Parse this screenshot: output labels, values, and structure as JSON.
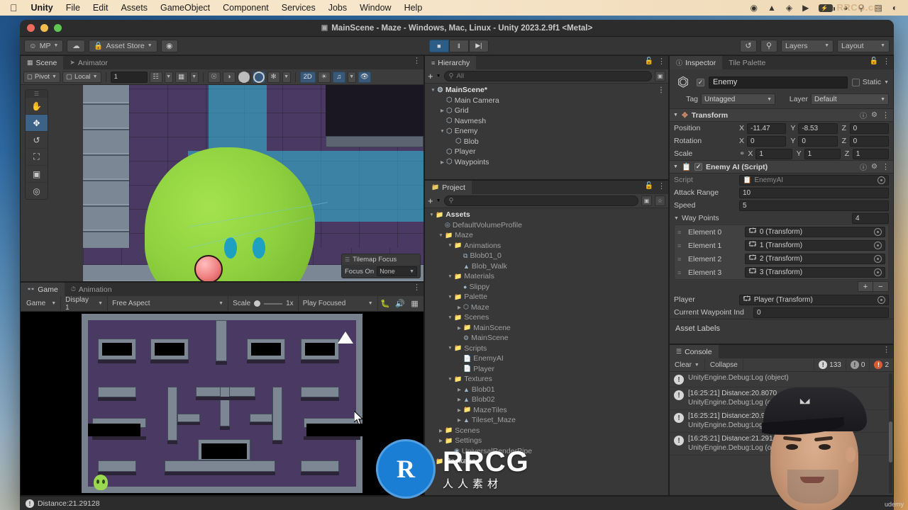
{
  "macos": {
    "menus": [
      "Unity",
      "File",
      "Edit",
      "Assets",
      "GameObject",
      "Component",
      "Services",
      "Jobs",
      "Window",
      "Help"
    ],
    "apple_glyph": "",
    "status_icons": [
      "record-icon",
      "vlc-icon",
      "unity-hub-icon",
      "playback-icon",
      "battery-icon",
      "wifi-icon",
      "search-icon",
      "control-center-icon",
      "siri-icon"
    ],
    "battery_label": "⚡",
    "watermark": "RRCG.cn"
  },
  "window": {
    "title": "MainScene - Maze - Windows, Mac, Linux - Unity 2023.2.9f1 <Metal>",
    "title_icon": "scene-icon"
  },
  "toolbar": {
    "account": "MP",
    "cloud_icon": "cloud-icon",
    "asset_store": "Asset Store",
    "settings_icon": "gear-icon",
    "play": "■",
    "pause": "‖",
    "step": "▶|",
    "history_icon": "undo-history-icon",
    "search_icon": "search-icon",
    "layers": "Layers",
    "layout": "Layout"
  },
  "scene_panel": {
    "tabs": [
      {
        "label": "Scene",
        "icon": "grid-icon",
        "active": true
      },
      {
        "label": "Animator",
        "icon": "animator-icon",
        "active": false
      }
    ],
    "toolbar": {
      "pivot": "Pivot",
      "local": "Local",
      "grid_size": "1",
      "snap_icon": "grid-snap-icon",
      "grid_icon": "grid-paint-icon",
      "two_d": "2D",
      "light_icon": "lighting-icon",
      "audio_icon": "audio-icon",
      "fx_icon": "effects-icon",
      "hidden_icon": "visibility-off-icon"
    },
    "tools_overlay": [
      "hand-tool",
      "move-tool",
      "rotate-tool",
      "scale-tool",
      "rect-tool",
      "transform-tool"
    ],
    "tools_active_index": 1,
    "tilemap_overlay": {
      "title": "Tilemap Focus",
      "row_label": "Focus On",
      "value": "None"
    }
  },
  "game_panel": {
    "tabs": [
      {
        "label": "Game",
        "icon": "game-icon",
        "active": true
      },
      {
        "label": "Animation",
        "icon": "animation-icon",
        "active": false
      }
    ],
    "toolbar": {
      "target": "Game",
      "display": "Display 1",
      "aspect": "Free Aspect",
      "scale_label": "Scale",
      "scale_value": "1x",
      "play_mode": "Play Focused",
      "stats_icon": "bug-icon",
      "mute_icon": "mute-audio-icon",
      "gizmos_icon": "gizmos-icon"
    }
  },
  "hierarchy": {
    "tab": "Hierarchy",
    "tab_icon": "hierarchy-icon",
    "lock_icon": "lock-icon",
    "kebab_icon": "kebab-menu-icon",
    "add_icon": "plus-icon",
    "search_placeholder": "All",
    "search_value": "",
    "items": [
      {
        "label": "MainScene*",
        "depth": 0,
        "arrow": "down",
        "icon": "scene-icon",
        "bold": true,
        "kebab": true
      },
      {
        "label": "Main Camera",
        "depth": 1,
        "arrow": "none",
        "icon": "gameobject-icon"
      },
      {
        "label": "Grid",
        "depth": 1,
        "arrow": "right",
        "icon": "gameobject-icon"
      },
      {
        "label": "Navmesh",
        "depth": 1,
        "arrow": "none",
        "icon": "gameobject-icon"
      },
      {
        "label": "Enemy",
        "depth": 1,
        "arrow": "down",
        "icon": "gameobject-icon"
      },
      {
        "label": "Blob",
        "depth": 2,
        "arrow": "none",
        "icon": "gameobject-icon"
      },
      {
        "label": "Player",
        "depth": 1,
        "arrow": "none",
        "icon": "gameobject-icon"
      },
      {
        "label": "Waypoints",
        "depth": 1,
        "arrow": "right",
        "icon": "gameobject-icon"
      }
    ]
  },
  "project": {
    "tab": "Project",
    "tab_icon": "folder-icon",
    "lock_icon": "lock-icon",
    "kebab_icon": "kebab-menu-icon",
    "add_icon": "plus-icon",
    "search_value": "",
    "items": [
      {
        "label": "Assets",
        "depth": 0,
        "arrow": "down",
        "icon": "folder-icon",
        "bold": true
      },
      {
        "label": "DefaultVolumeProfile",
        "depth": 1,
        "arrow": "none",
        "icon": "volume-profile-icon"
      },
      {
        "label": "Maze",
        "depth": 1,
        "arrow": "down",
        "icon": "folder-icon"
      },
      {
        "label": "Animations",
        "depth": 2,
        "arrow": "down",
        "icon": "folder-icon"
      },
      {
        "label": "Blob01_0",
        "depth": 3,
        "arrow": "none",
        "icon": "animation-clip-icon"
      },
      {
        "label": "Blob_Walk",
        "depth": 3,
        "arrow": "none",
        "icon": "animator-controller-icon"
      },
      {
        "label": "Materials",
        "depth": 2,
        "arrow": "down",
        "icon": "folder-icon"
      },
      {
        "label": "Slippy",
        "depth": 3,
        "arrow": "none",
        "icon": "material-icon"
      },
      {
        "label": "Palette",
        "depth": 2,
        "arrow": "down",
        "icon": "folder-icon"
      },
      {
        "label": "Maze",
        "depth": 3,
        "arrow": "right",
        "icon": "prefab-icon"
      },
      {
        "label": "Scenes",
        "depth": 2,
        "arrow": "down",
        "icon": "folder-icon"
      },
      {
        "label": "MainScene",
        "depth": 3,
        "arrow": "right",
        "icon": "folder-icon"
      },
      {
        "label": "MainScene",
        "depth": 3,
        "arrow": "none",
        "icon": "scene-icon"
      },
      {
        "label": "Scripts",
        "depth": 2,
        "arrow": "down",
        "icon": "folder-icon"
      },
      {
        "label": "EnemyAI",
        "depth": 3,
        "arrow": "none",
        "icon": "script-icon"
      },
      {
        "label": "Player",
        "depth": 3,
        "arrow": "none",
        "icon": "script-icon"
      },
      {
        "label": "Textures",
        "depth": 2,
        "arrow": "down",
        "icon": "folder-icon"
      },
      {
        "label": "Blob01",
        "depth": 3,
        "arrow": "right",
        "icon": "texture-icon"
      },
      {
        "label": "Blob02",
        "depth": 3,
        "arrow": "right",
        "icon": "texture-icon"
      },
      {
        "label": "MazeTiles",
        "depth": 3,
        "arrow": "right",
        "icon": "folder-icon"
      },
      {
        "label": "Tileset_Maze",
        "depth": 3,
        "arrow": "right",
        "icon": "texture-icon"
      },
      {
        "label": "Scenes",
        "depth": 1,
        "arrow": "right",
        "icon": "folder-icon"
      },
      {
        "label": "Settings",
        "depth": 1,
        "arrow": "right",
        "icon": "folder-icon"
      },
      {
        "label": "UniversalRenderPipe",
        "depth": 2,
        "arrow": "none",
        "icon": "render-pipeline-icon"
      },
      {
        "label": "Packages",
        "depth": 0,
        "arrow": "right",
        "icon": "folder-icon",
        "bold": true
      }
    ]
  },
  "inspector": {
    "tabs": [
      {
        "label": "Inspector",
        "icon": "info-icon",
        "active": true
      },
      {
        "label": "Tile Palette",
        "icon": "tile-palette-icon",
        "active": false
      }
    ],
    "lock_icon": "lock-icon",
    "kebab_icon": "kebab-menu-icon",
    "object": {
      "enabled": true,
      "name": "Enemy",
      "static_label": "Static",
      "static_checked": false,
      "tag_label": "Tag",
      "tag_value": "Untagged",
      "layer_label": "Layer",
      "layer_value": "Default"
    },
    "transform": {
      "title": "Transform",
      "icon": "transform-icon",
      "rows": [
        {
          "label": "Position",
          "x": "-11.47",
          "y": "-8.53",
          "z": "0",
          "link": false
        },
        {
          "label": "Rotation",
          "x": "0",
          "y": "0",
          "z": "0",
          "link": false
        },
        {
          "label": "Scale",
          "x": "1",
          "y": "1",
          "z": "1",
          "link": true
        }
      ]
    },
    "script_component": {
      "title": "Enemy AI (Script)",
      "icon": "script-icon",
      "enabled": true,
      "script_label": "Script",
      "script_value": "EnemyAI",
      "fields": [
        {
          "label": "Attack Range",
          "value": "10"
        },
        {
          "label": "Speed",
          "value": "5"
        }
      ],
      "array": {
        "label": "Way Points",
        "size": "4",
        "elements": [
          {
            "label": "Element 0",
            "value": "0 (Transform)"
          },
          {
            "label": "Element 1",
            "value": "1 (Transform)"
          },
          {
            "label": "Element 2",
            "value": "2 (Transform)"
          },
          {
            "label": "Element 3",
            "value": "3 (Transform)"
          }
        ],
        "add_label": "+",
        "remove_label": "−"
      },
      "after_fields": [
        {
          "label": "Player",
          "value": "Player (Transform)",
          "is_object": true
        },
        {
          "label": "Current Waypoint Ind",
          "value": "0",
          "is_object": false
        }
      ]
    },
    "asset_labels": "Asset Labels"
  },
  "console": {
    "tab": "Console",
    "tab_icon": "console-icon",
    "kebab_icon": "kebab-menu-icon",
    "clear": "Clear",
    "collapse": "Collapse",
    "counts": {
      "info": "133",
      "warning": "0",
      "error": "2"
    },
    "entries": [
      {
        "line1": "",
        "line2": "UnityEngine.Debug:Log (object)",
        "partial": true
      },
      {
        "line1": "[16:25:21] Distance:20.8070",
        "line2": "UnityEngine.Debug:Log (ol"
      },
      {
        "line1": "[16:25:21] Distance:20.94",
        "line2": "UnityEngine.Debug:Log (o"
      },
      {
        "line1": "[16:25:21] Distance:21.291",
        "line2": "UnityEngine.Debug:Log (ob"
      }
    ]
  },
  "statusbar": {
    "message": "Distance:21.29128",
    "icon": "log-icon"
  },
  "watermark": {
    "logo_char": "R",
    "brand": "RRCG",
    "subtitle": "人人素材",
    "corner": "udemy",
    "brand_color": "#1a7fd4"
  }
}
